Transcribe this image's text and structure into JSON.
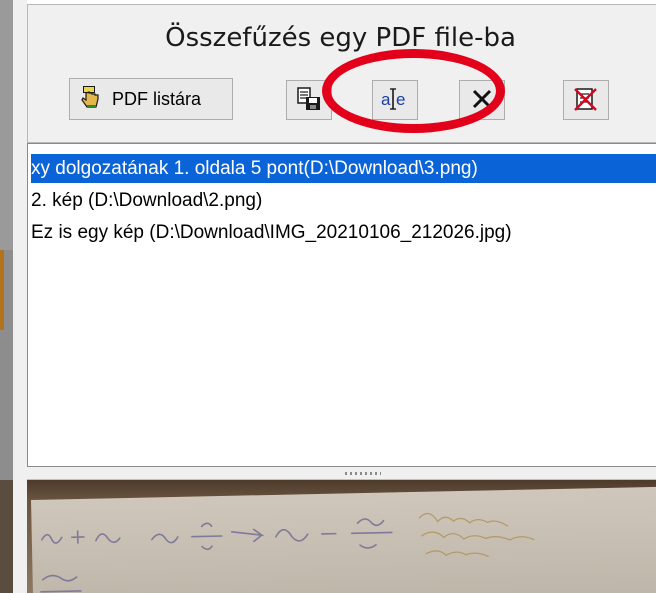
{
  "panel": {
    "title": "Összefűzés egy PDF file-ba"
  },
  "toolbar": {
    "pdf_button_label": "PDF listára",
    "icons": {
      "pdf": "pdf-hand-icon",
      "save": "save-list-icon",
      "rename": "rename-text-icon",
      "delete": "delete-x-icon",
      "clear": "clear-list-icon"
    }
  },
  "list": {
    "items": [
      {
        "label": "xy dolgozatának 1. oldala 5 pont(D:\\Download\\3.png)",
        "selected": true
      },
      {
        "label": "2. kép (D:\\Download\\2.png)",
        "selected": false
      },
      {
        "label": "Ez is egy kép (D:\\Download\\IMG_20210106_212026.jpg)",
        "selected": false
      }
    ]
  },
  "colors": {
    "highlight_oval": "#e3001b",
    "selection": "#0a64d8"
  },
  "preview": {
    "image_name": "handwritten-paper-photo"
  }
}
